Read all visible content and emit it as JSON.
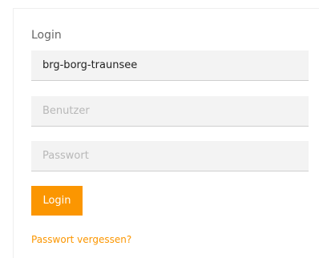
{
  "login": {
    "heading": "Login",
    "school": {
      "value": "brg-borg-traunsee"
    },
    "username": {
      "value": "",
      "placeholder": "Benutzer"
    },
    "password": {
      "value": "",
      "placeholder": "Passwort"
    },
    "submit_label": "Login",
    "forgot_password": "Passwort vergessen?"
  },
  "colors": {
    "accent": "#fb9601",
    "field_background": "#f3f3f3",
    "heading_text": "#666666",
    "placeholder_text": "#b8b8b8"
  }
}
